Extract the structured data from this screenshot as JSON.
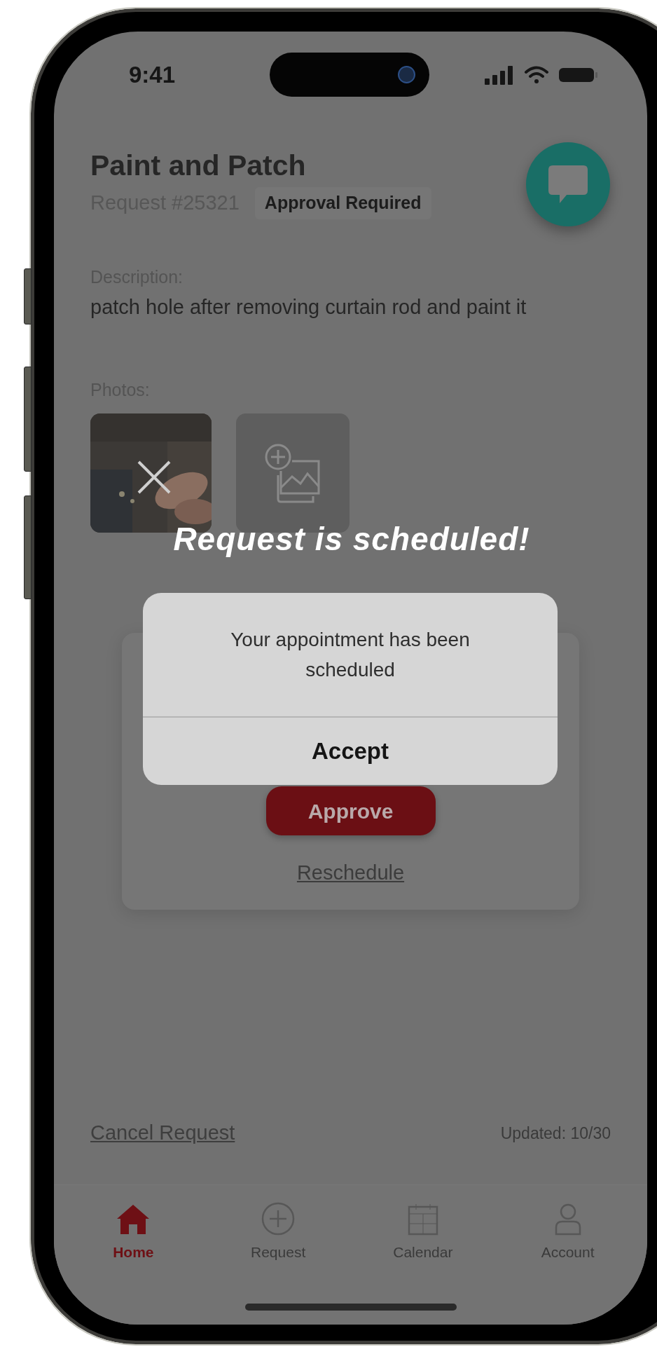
{
  "status_bar": {
    "time": "9:41"
  },
  "request": {
    "title": "Paint and Patch",
    "number": "Request #25321",
    "status": "Approval Required"
  },
  "description": {
    "label": "Description:",
    "text": "patch hole after removing curtain rod and paint it"
  },
  "photos": {
    "label": "Photos:",
    "items": [
      {
        "kind": "picture"
      },
      {
        "kind": "add"
      }
    ]
  },
  "banner": "Request is scheduled!",
  "alert": {
    "message": "Your appointment has been scheduled",
    "button": "Accept"
  },
  "card": {
    "primary_button": "Approve",
    "link": "Reschedule"
  },
  "footer": {
    "cancel": "Cancel Request",
    "updated": "Updated: 10/30"
  },
  "tab_bar": [
    {
      "label": "Home",
      "kind": "home",
      "selected": true
    },
    {
      "label": "Request",
      "kind": "add",
      "selected": false
    },
    {
      "label": "Calendar",
      "kind": "calendar",
      "selected": false
    },
    {
      "label": "Account",
      "kind": "account",
      "selected": false
    }
  ]
}
